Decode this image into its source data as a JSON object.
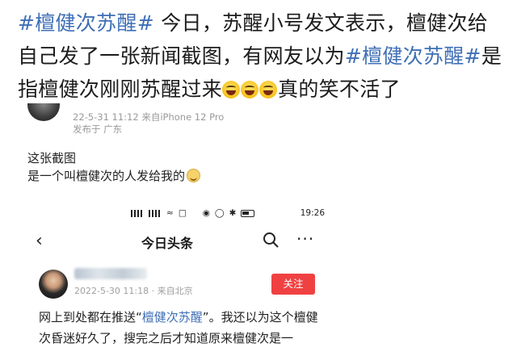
{
  "headline": {
    "tag1": "#檀健次苏醒#",
    "text1": " 今日，苏醒小号发文表示，檀健次给自己发了一张新闻截图，有网友以为",
    "tag2": "#檀健次苏醒#",
    "text2": "是指檀健次刚刚苏醒过来",
    "emoji_icon": "laughing-crying-emoji",
    "emoji_count": 3,
    "text3": "真的笑不活了"
  },
  "post": {
    "date_line": "22-5-31 11:12  来自iPhone 12 Pro",
    "location_line": "发布于 广东",
    "line1": "这张截图",
    "line2": "是一个叫檀健次的人发给我的",
    "emoji_icon": "smiling-face-emoji"
  },
  "statusbar": {
    "time": "19:26"
  },
  "news_app": {
    "nav_title": "今日头条",
    "back_icon": "chevron-left-icon",
    "search_icon": "search-icon",
    "more_icon": "more-dots-icon",
    "meta": "2022-5-30 11:18 · 来自北京",
    "follow_label": "关注",
    "body_prefix": "网上到处都在推送“",
    "body_highlight": "檀健次苏醒",
    "body_suffix": "”。我还以为这个檀健次昏迷好久了，搜完之后才知道原来檀健次是一",
    "colors": {
      "follow": "#f04142",
      "link": "#3f6fb6"
    }
  }
}
